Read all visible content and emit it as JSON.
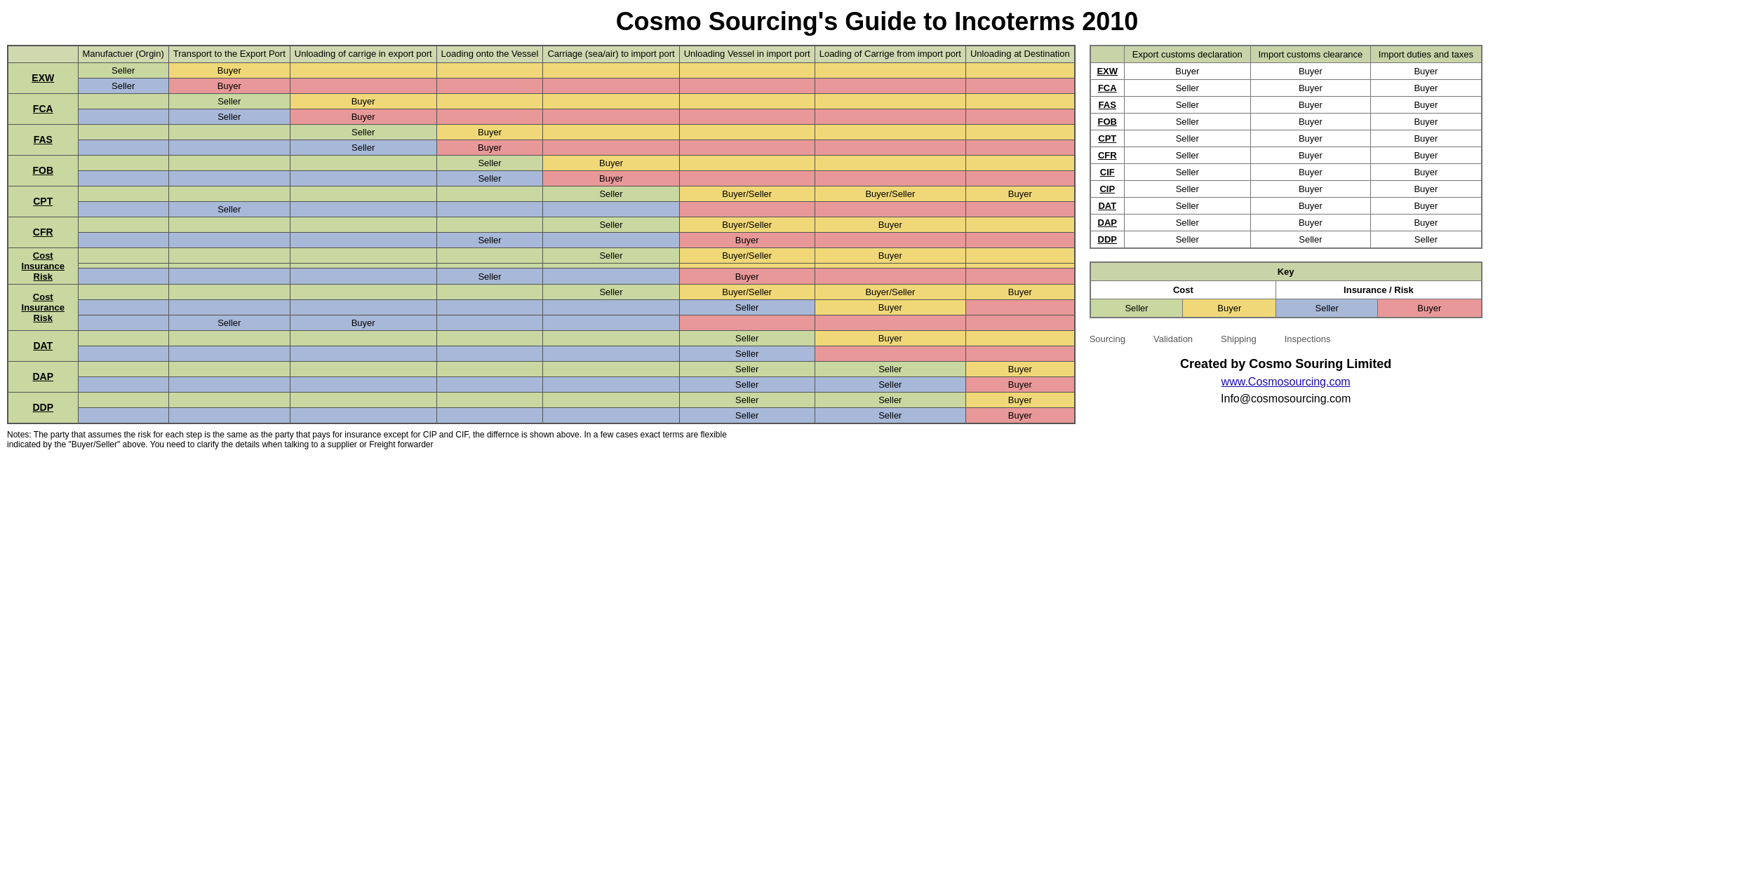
{
  "title": "Cosmo Sourcing's Guide to Incoterms 2010",
  "headers": {
    "col0": "",
    "col1": "Manufactuer (Orgin)",
    "col2": "Transport to the Export Port",
    "col3": "Unloading of carrige in export port",
    "col4": "Loading onto the Vessel",
    "col5": "Carriage (sea/air) to import port",
    "col6": "Unloading Vessel in import port",
    "col7": "Loading of Carrige from import port",
    "col8": "Unloading at Destination"
  },
  "right_headers": {
    "term": "",
    "export": "Export customs declaration",
    "import_clearance": "Import customs clearance",
    "import_duties": "Import duties and taxes"
  },
  "right_rows": [
    {
      "term": "EXW",
      "export": "Buyer",
      "clearance": "Buyer",
      "duties": "Buyer"
    },
    {
      "term": "FCA",
      "export": "Seller",
      "clearance": "Buyer",
      "duties": "Buyer"
    },
    {
      "term": "FAS",
      "export": "Seller",
      "clearance": "Buyer",
      "duties": "Buyer"
    },
    {
      "term": "FOB",
      "export": "Seller",
      "clearance": "Buyer",
      "duties": "Buyer"
    },
    {
      "term": "CPT",
      "export": "Seller",
      "clearance": "Buyer",
      "duties": "Buyer"
    },
    {
      "term": "CFR",
      "export": "Seller",
      "clearance": "Buyer",
      "duties": "Buyer"
    },
    {
      "term": "CIF",
      "export": "Seller",
      "clearance": "Buyer",
      "duties": "Buyer"
    },
    {
      "term": "CIP",
      "export": "Seller",
      "clearance": "Buyer",
      "duties": "Buyer"
    },
    {
      "term": "DAT",
      "export": "Seller",
      "clearance": "Buyer",
      "duties": "Buyer"
    },
    {
      "term": "DAP",
      "export": "Seller",
      "clearance": "Buyer",
      "duties": "Buyer"
    },
    {
      "term": "DDP",
      "export": "Seller",
      "clearance": "Seller",
      "duties": "Seller"
    }
  ],
  "key": {
    "title": "Key",
    "cost_label": "Cost",
    "insurance_label": "Insurance / Risk",
    "seller_cost": "Seller",
    "buyer_cost": "Buyer",
    "seller_insurance": "Seller",
    "buyer_insurance": "Buyer"
  },
  "services": [
    "Sourcing",
    "Validation",
    "Shipping",
    "Inspections"
  ],
  "company_name": "Created by Cosmo Souring Limited",
  "website": "www.Cosmosourcing.com",
  "email": "Info@cosmosourcing.com",
  "notes": "Notes: The party that assumes the risk for each step is the same as the party that pays for insurance except for CIP and CIF, the differnce is shown above.\nIn a few cases exact terms are flexible indicated by the \"Buyer/Seller\" above. You need to clarify the details when talking to a supplier or Freight forwarder"
}
